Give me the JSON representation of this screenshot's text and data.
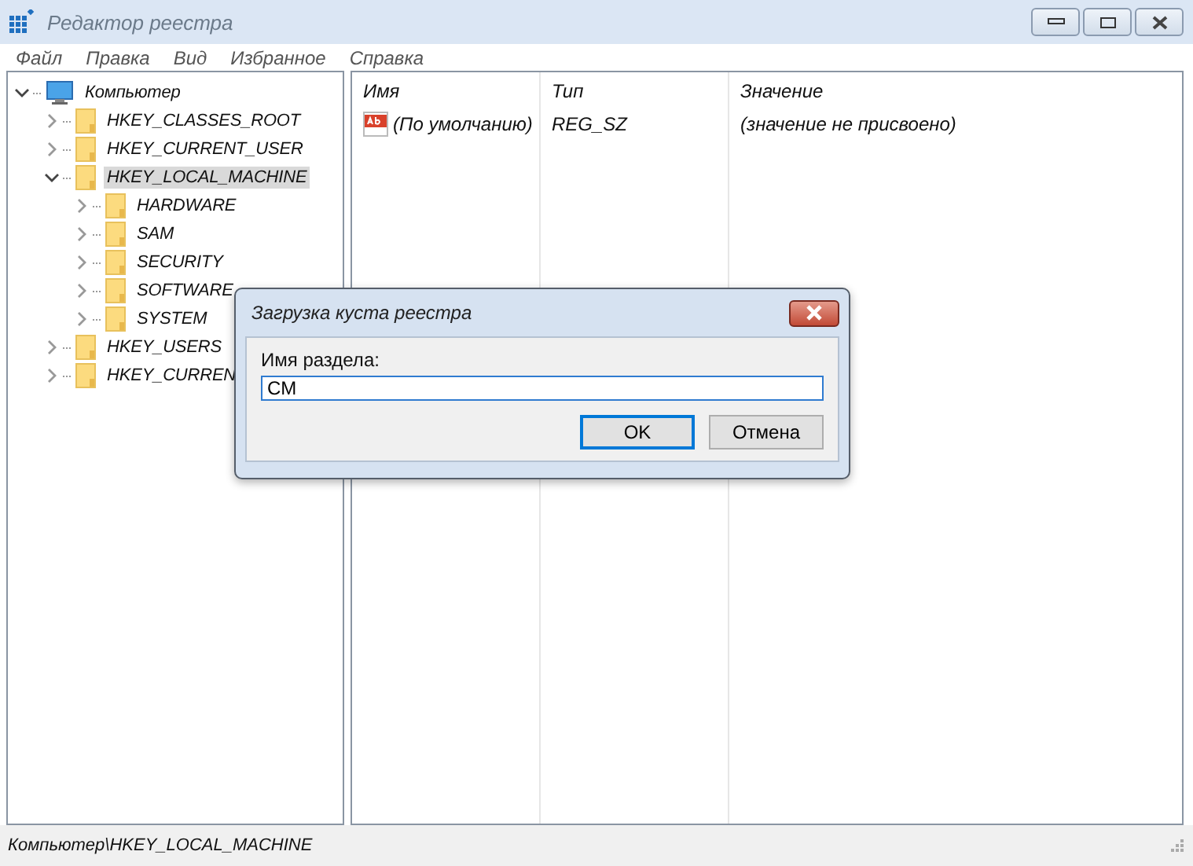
{
  "window": {
    "title": "Редактор реестра"
  },
  "menu": [
    "Файл",
    "Правка",
    "Вид",
    "Избранное",
    "Справка"
  ],
  "tree": [
    {
      "label": "Компьютер",
      "kind": "computer",
      "expanded": true,
      "selected": false,
      "children": [
        {
          "label": "HKEY_CLASSES_ROOT",
          "kind": "folder",
          "expanded": false,
          "selected": false
        },
        {
          "label": "HKEY_CURRENT_USER",
          "kind": "folder",
          "expanded": false,
          "selected": false
        },
        {
          "label": "HKEY_LOCAL_MACHINE",
          "kind": "folder",
          "expanded": true,
          "selected": true,
          "children": [
            {
              "label": "HARDWARE",
              "kind": "folder",
              "expanded": false,
              "selected": false
            },
            {
              "label": "SAM",
              "kind": "folder",
              "expanded": false,
              "selected": false
            },
            {
              "label": "SECURITY",
              "kind": "folder",
              "expanded": false,
              "selected": false
            },
            {
              "label": "SOFTWARE",
              "kind": "folder",
              "expanded": false,
              "selected": false
            },
            {
              "label": "SYSTEM",
              "kind": "folder",
              "expanded": false,
              "selected": false
            }
          ]
        },
        {
          "label": "HKEY_USERS",
          "kind": "folder",
          "expanded": false,
          "selected": false
        },
        {
          "label": "HKEY_CURREN",
          "kind": "folder",
          "expanded": false,
          "selected": false
        }
      ]
    }
  ],
  "table": {
    "columns": [
      "Имя",
      "Тип",
      "Значение"
    ],
    "rows": [
      {
        "name": "(По умолчанию)",
        "type": "REG_SZ",
        "value": "(значение не присвоено)"
      }
    ]
  },
  "status_bar": "Компьютер\\HKEY_LOCAL_MACHINE",
  "dialog": {
    "title": "Загрузка куста реестра",
    "label": "Имя раздела:",
    "value": "CM",
    "buttons": [
      {
        "label": "OK",
        "default": true
      },
      {
        "label": "Отмена",
        "default": false
      }
    ]
  }
}
